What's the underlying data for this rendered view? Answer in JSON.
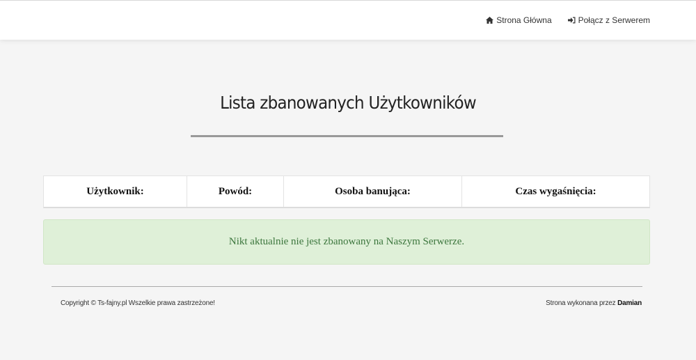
{
  "nav": {
    "home_label": "Strona Główna",
    "home_icon": "home-icon",
    "connect_label": "Połącz z Serwerem",
    "connect_icon": "sign-in-icon"
  },
  "main": {
    "title": "Lista zbanowanych Użytkowników",
    "table": {
      "headers": [
        "Użytkownik:",
        "Powód:",
        "Osoba banująca:",
        "Czas wygaśnięcia:"
      ]
    },
    "alert": {
      "text": "Nikt aktualnie nie jest zbanowany na Naszym Serwerze.",
      "color": "#dff0d8"
    }
  },
  "footer": {
    "copyright": "Copyright © Ts-fajny.pl Wszelkie prawa zastrzeżone!",
    "credit_prefix": "Strona wykonana przez",
    "credit_author": "Damian"
  }
}
